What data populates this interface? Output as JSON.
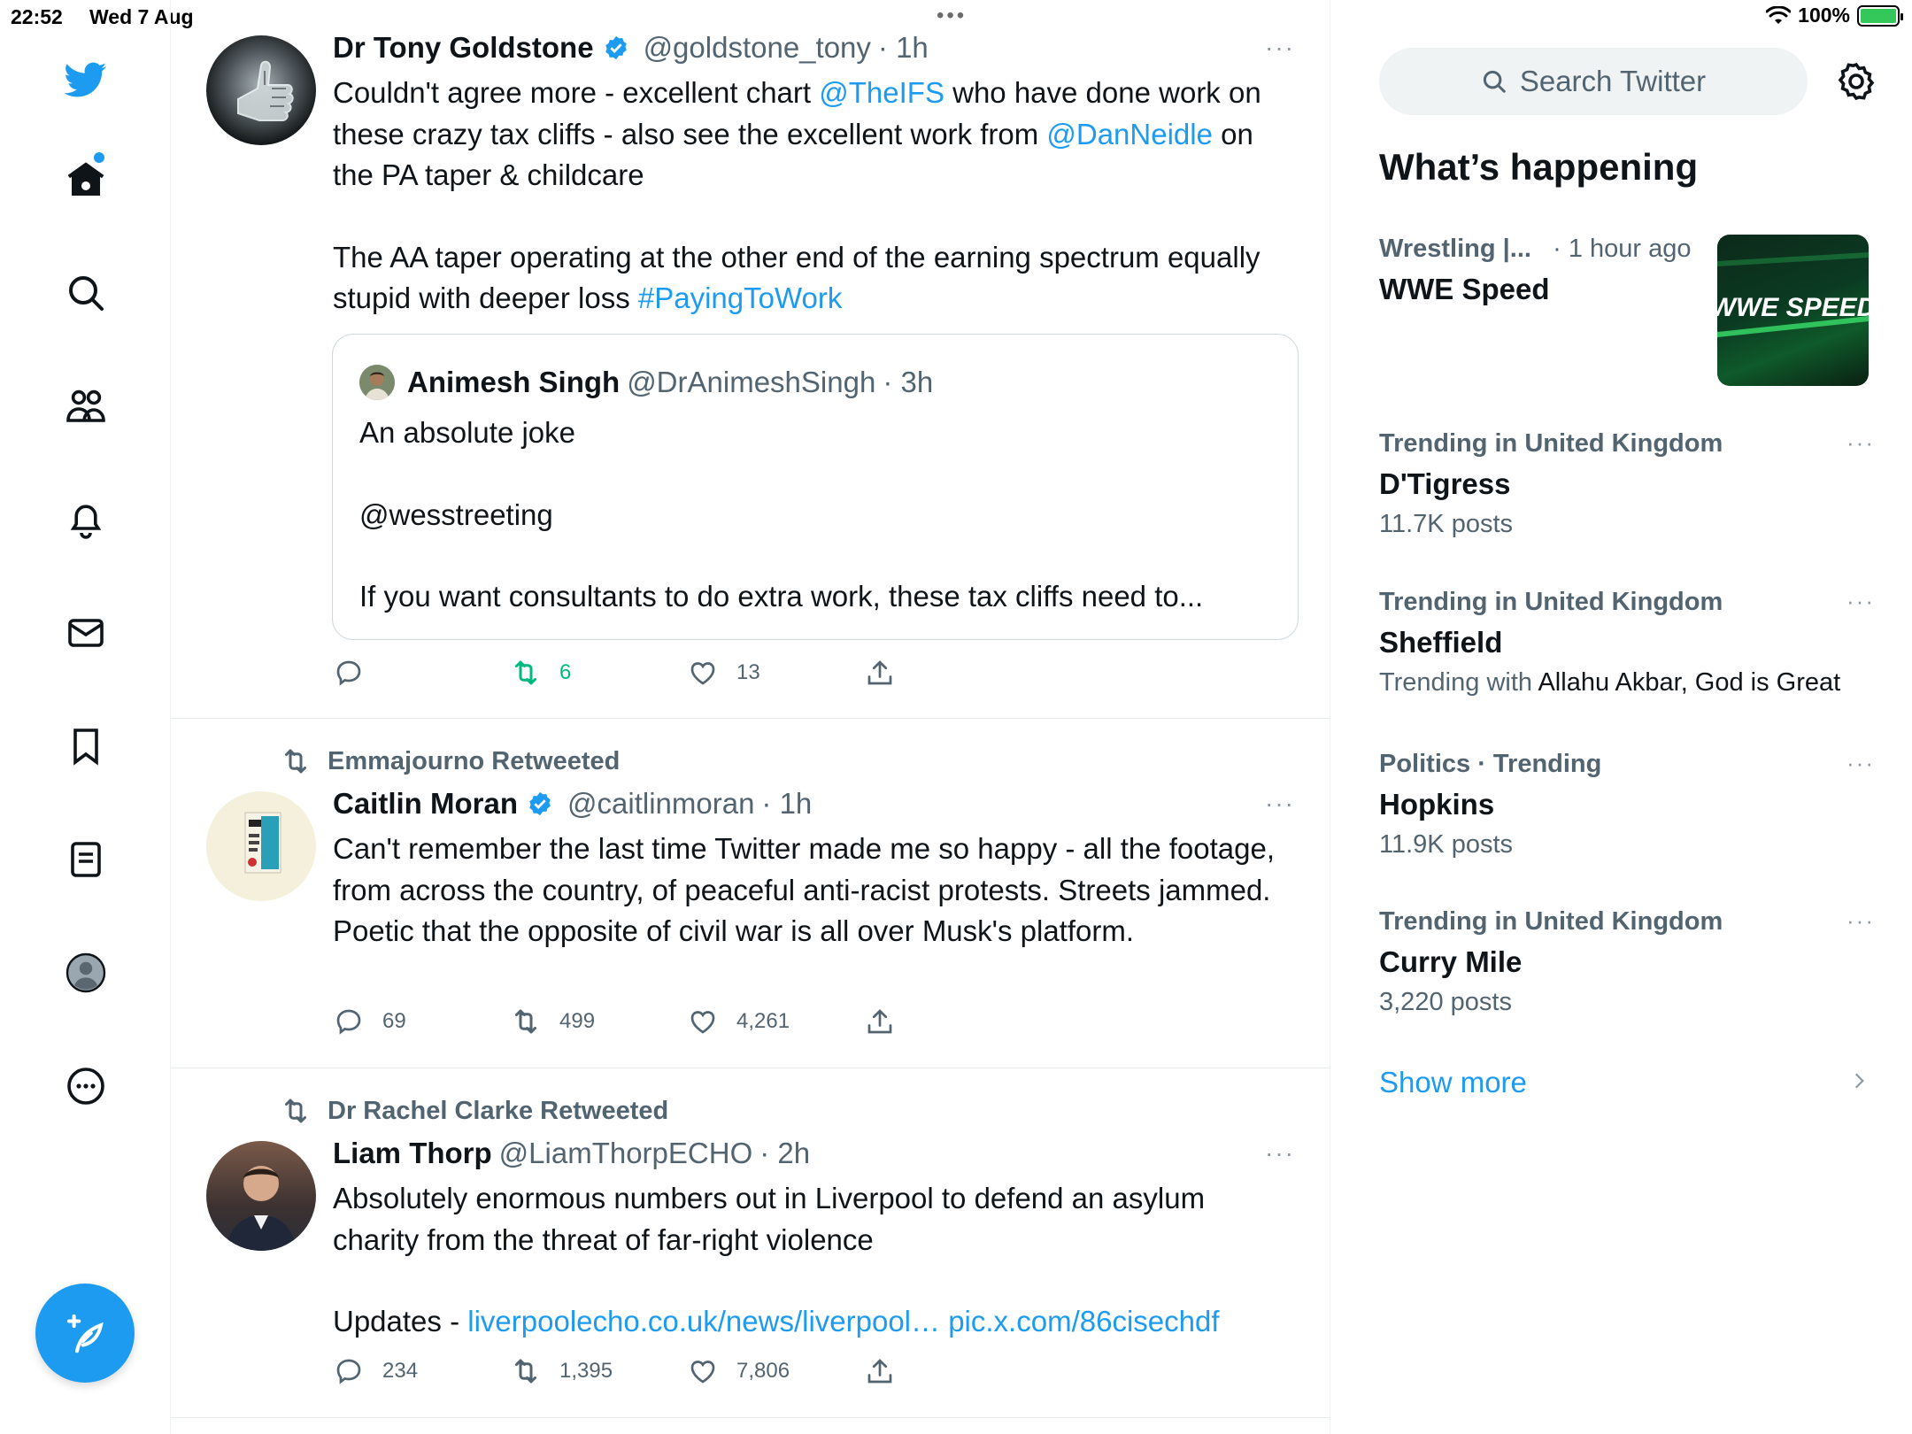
{
  "status": {
    "time": "22:52",
    "date": "Wed 7 Aug",
    "battery": "100%"
  },
  "nav": {
    "items": [
      "home",
      "explore",
      "communities",
      "notifications",
      "messages",
      "bookmarks",
      "lists",
      "profile",
      "more"
    ]
  },
  "tweets": [
    {
      "name": "Dr Tony Goldstone",
      "handle": "@goldstone_tony",
      "time": "· 1h",
      "more": "···",
      "text_l1_a": "Couldn't agree more - excellent chart ",
      "text_l1_link": "@TheIFS",
      "text_l1_b": " who have done work on these crazy tax cliffs - also see the excellent work from ",
      "text_l1_link2": "@DanNeidle",
      "text_l1_c": " on the PA taper & childcare",
      "text_l2_a": "The AA taper operating at the other end of the earning spectrum equally stupid with deeper loss ",
      "text_l2_link": "#PayingToWork",
      "quote": {
        "name": "Animesh Singh",
        "handle": "@DrAnimeshSingh",
        "time": "· 3h",
        "line1": "An absolute joke",
        "line2": "@wesstreeting",
        "line3": "If you want consultants to do extra work, these tax cliffs need to..."
      },
      "replies": "",
      "retweets": "6",
      "likes": "13"
    },
    {
      "retweeted_by": "Emmajourno Retweeted",
      "name": "Caitlin Moran",
      "handle": "@caitlinmoran",
      "time": "· 1h",
      "more": "···",
      "text": "Can't remember the last time Twitter made me so happy - all the footage, from across the country, of peaceful anti-racist protests. Streets jammed. Poetic that the opposite of civil war is all over Musk's platform.",
      "replies": "69",
      "retweets": "499",
      "likes": "4,261"
    },
    {
      "retweeted_by": "Dr Rachel Clarke Retweeted",
      "name": "Liam Thorp",
      "handle": "@LiamThorpECHO",
      "time": "· 2h",
      "more": "···",
      "text": "Absolutely enormous numbers out in Liverpool to defend an asylum charity from the threat of far-right violence",
      "updates_label": "Updates - ",
      "updates_link": "liverpoolecho.co.uk/news/liverpool…",
      "pic_link": "pic.x.com/86cisechdf",
      "replies": "234",
      "retweets": "1,395",
      "likes": "7,806"
    }
  ],
  "sidebar": {
    "search_placeholder": "Search Twitter",
    "title": "What’s happening",
    "trends": [
      {
        "meta": "Wrestling |...",
        "meta_time": "· 1 hour ago",
        "name": "WWE Speed",
        "image": "WWE SPEED"
      },
      {
        "meta": "Trending in United Kingdom",
        "name": "D'Tigress",
        "count": "11.7K posts",
        "more": "···"
      },
      {
        "meta": "Trending in United Kingdom",
        "name": "Sheffield",
        "count_prefix": "Trending with ",
        "count_rest": "Allahu Akbar, God is Great",
        "more": "···"
      },
      {
        "meta": "Politics · Trending",
        "name": "Hopkins",
        "count": "11.9K posts",
        "more": "···"
      },
      {
        "meta": "Trending in United Kingdom",
        "name": "Curry Mile",
        "count": "3,220 posts",
        "more": "···"
      }
    ],
    "show_more": "Show more"
  },
  "colors": {
    "accent": "#1d9bf0",
    "retweet_green": "#00ba7c",
    "secondary_text": "#536471"
  }
}
